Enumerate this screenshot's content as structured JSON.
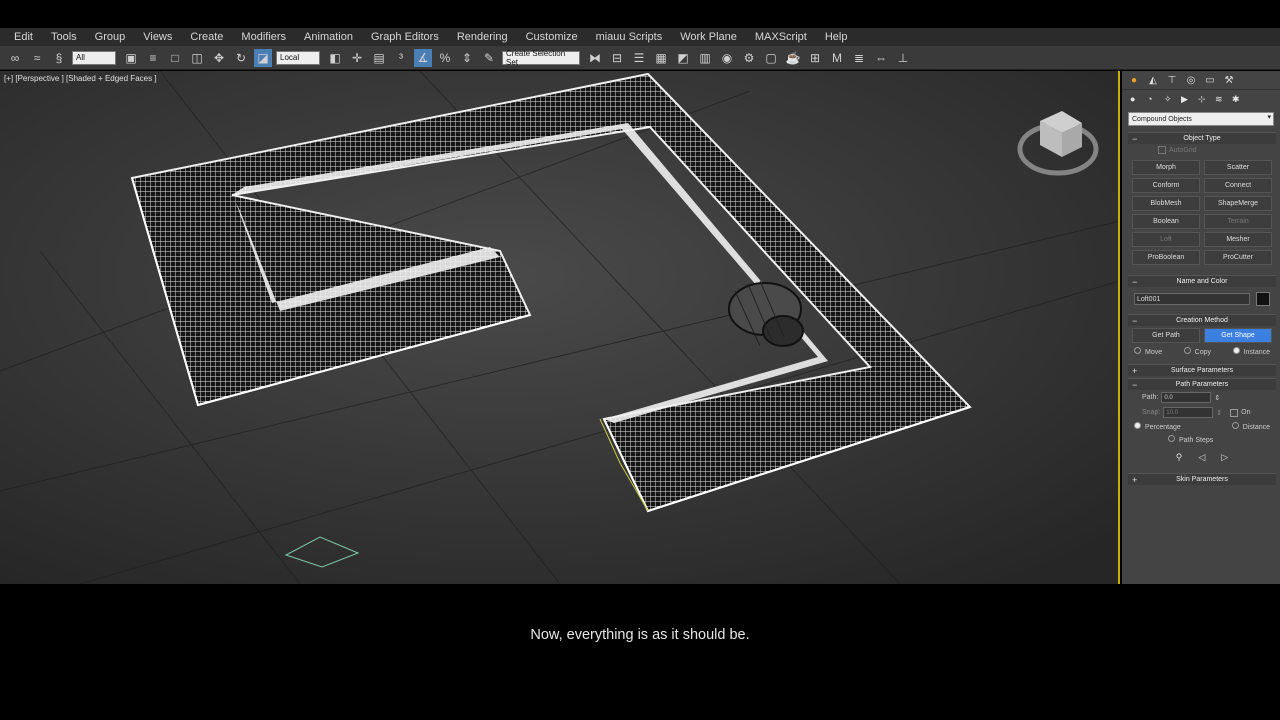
{
  "menu": [
    "Edit",
    "Tools",
    "Group",
    "Views",
    "Create",
    "Modifiers",
    "Animation",
    "Graph Editors",
    "Rendering",
    "Customize",
    "miauu Scripts",
    "Work Plane",
    "MAXScript",
    "Help"
  ],
  "toolbar": {
    "filter_value": "All",
    "coord_value": "Local",
    "selection_set_value": "Create Selection Set"
  },
  "viewport": {
    "label": "[+] [Perspective ] [Shaded + Edged Faces ]"
  },
  "command_panel": {
    "category_value": "Compound Objects",
    "object_type": {
      "title": "Object Type",
      "autogrid": "AutoGrid",
      "buttons": [
        {
          "label": "Morph",
          "enabled": true
        },
        {
          "label": "Scatter",
          "enabled": true
        },
        {
          "label": "Conform",
          "enabled": true
        },
        {
          "label": "Connect",
          "enabled": true
        },
        {
          "label": "BlobMesh",
          "enabled": true
        },
        {
          "label": "ShapeMerge",
          "enabled": true
        },
        {
          "label": "Boolean",
          "enabled": true
        },
        {
          "label": "Terrain",
          "enabled": false
        },
        {
          "label": "Loft",
          "enabled": false
        },
        {
          "label": "Mesher",
          "enabled": true
        },
        {
          "label": "ProBoolean",
          "enabled": true
        },
        {
          "label": "ProCutter",
          "enabled": true
        }
      ]
    },
    "name_color": {
      "title": "Name and Color",
      "name": "Loft001"
    },
    "creation_method": {
      "title": "Creation Method",
      "get_path": "Get Path",
      "get_shape": "Get Shape",
      "move": "Move",
      "copy": "Copy",
      "instance": "Instance"
    },
    "surface_parameters": "Surface Parameters",
    "path_parameters": {
      "title": "Path Parameters",
      "path_label": "Path:",
      "path_value": "0.0",
      "snap_label": "Snap:",
      "snap_value": "10.0",
      "on_label": "On",
      "percentage": "Percentage",
      "distance": "Distance",
      "path_steps": "Path Steps"
    },
    "skin_parameters": "Skin Parameters"
  },
  "caption": "Now, everything is as it should be."
}
